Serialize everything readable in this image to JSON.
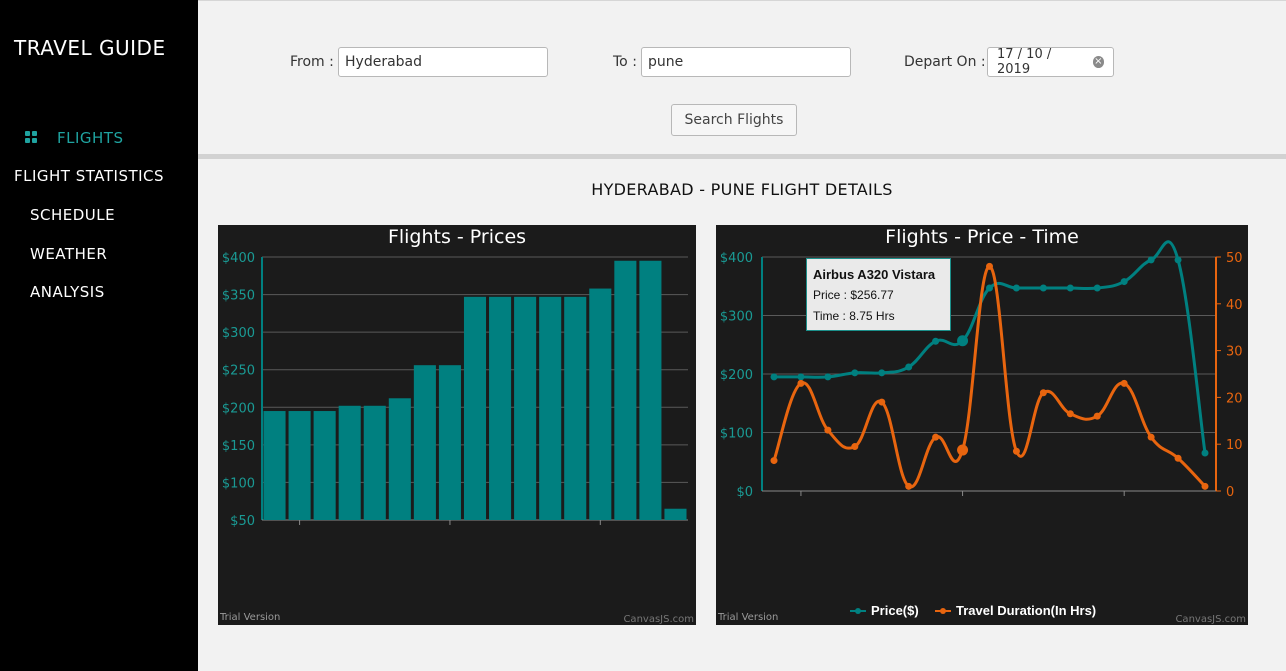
{
  "sidebar": {
    "brand": "TRAVEL GUIDE",
    "items": [
      {
        "label": "FLIGHTS"
      },
      {
        "label": "FLIGHT STATISTICS"
      },
      {
        "label": "SCHEDULE"
      },
      {
        "label": "WEATHER"
      },
      {
        "label": "ANALYSIS"
      }
    ]
  },
  "search": {
    "from_label": "From :",
    "from_value": "Hyderabad",
    "to_label": "To :",
    "to_value": "pune",
    "depart_label": "Depart On :",
    "depart_value": "17 / 10 / 2019",
    "button": "Search Flights"
  },
  "details_title": "HYDERABAD - PUNE FLIGHT DETAILS",
  "colors": {
    "teal": "#008080",
    "orange": "#e8650f",
    "accent": "#1fa3a0"
  },
  "chart_data": [
    {
      "type": "bar",
      "title": "Flights - Prices",
      "ylim": [
        50,
        400
      ],
      "yticks": [
        "$400",
        "$350",
        "$300",
        "$250",
        "$200",
        "$150",
        "$100",
        "$50"
      ],
      "values": [
        195,
        195,
        195,
        202,
        202,
        212,
        256,
        256,
        347,
        347,
        347,
        347,
        347,
        358,
        395,
        395,
        65
      ],
      "footer_left": "Trial Version",
      "footer_right": "CanvasJS.com",
      "grid": true
    },
    {
      "type": "line",
      "title": "Flights - Price - Time",
      "ylim": [
        0,
        400
      ],
      "y2lim": [
        0,
        50
      ],
      "yticks": [
        "$400",
        "$300",
        "$200",
        "$100",
        "$0"
      ],
      "y2ticks": [
        "50",
        "40",
        "30",
        "20",
        "10",
        "0"
      ],
      "series": [
        {
          "name": "Price($)",
          "values": [
            195,
            195,
            195,
            202,
            202,
            212,
            256,
            256.77,
            347,
            347,
            347,
            347,
            347,
            358,
            395,
            395,
            65
          ]
        },
        {
          "name": "Travel Duration(In Hrs)",
          "values": [
            6.5,
            23,
            13,
            9.5,
            19,
            1,
            11.5,
            8.75,
            48,
            8.5,
            21,
            16.5,
            16,
            23,
            11.5,
            7,
            1
          ]
        }
      ],
      "tooltip": {
        "title": "Airbus A320 Vistara",
        "price": "Price : $256.77",
        "time": "Time : 8.75 Hrs"
      },
      "footer_left": "Trial Version",
      "footer_right": "CanvasJS.com",
      "grid": true
    }
  ]
}
